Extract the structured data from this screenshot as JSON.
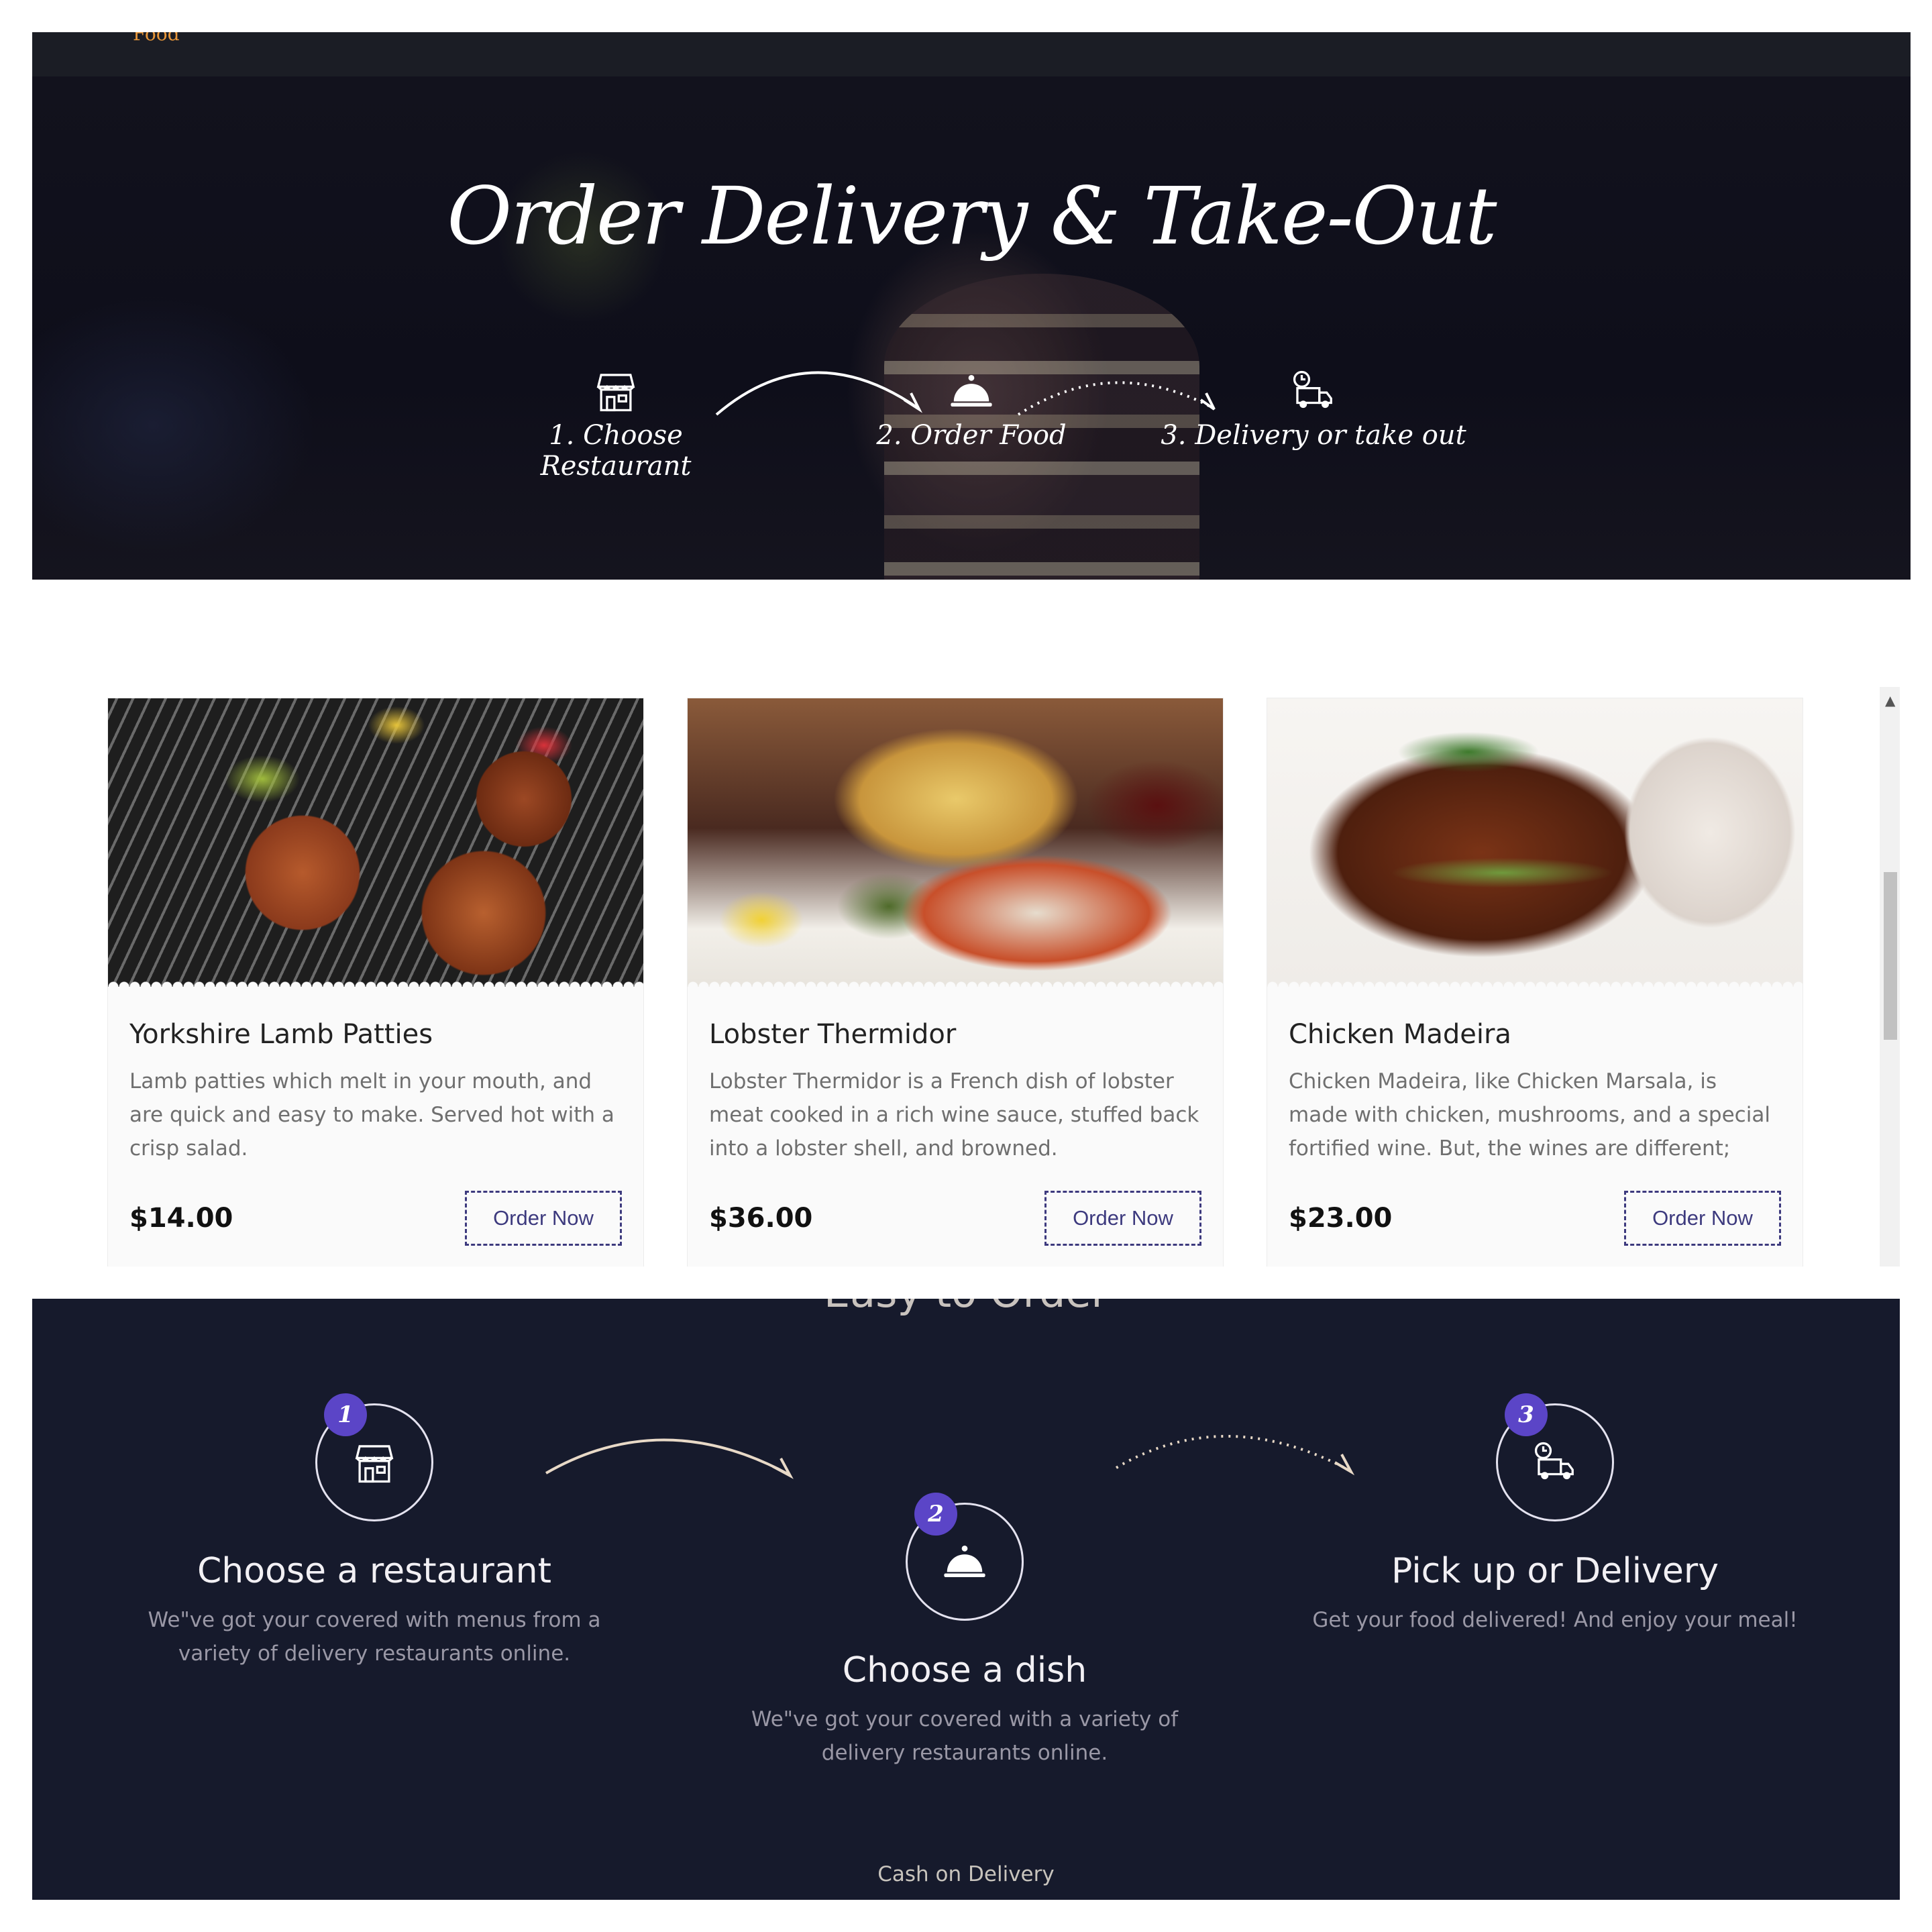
{
  "hero": {
    "logo_text": "Food",
    "title": "Order Delivery & Take-Out",
    "steps": [
      {
        "label": "1. Choose Restaurant",
        "icon": "store-icon"
      },
      {
        "label": "2. Order Food",
        "icon": "cloche-icon"
      },
      {
        "label": "3. Delivery or take out",
        "icon": "delivery-truck-icon"
      }
    ]
  },
  "cards": [
    {
      "name": "Yorkshire Lamb Patties",
      "description": "Lamb patties which melt in your mouth, and are quick and easy to make. Served hot with a crisp salad.",
      "price": "$14.00",
      "button": "Order Now"
    },
    {
      "name": "Lobster Thermidor",
      "description": "Lobster Thermidor is a French dish of lobster meat cooked in a rich wine sauce, stuffed back into a lobster shell, and browned.",
      "price": "$36.00",
      "button": "Order Now"
    },
    {
      "name": "Chicken Madeira",
      "description": "Chicken Madeira, like Chicken Marsala, is made with chicken, mushrooms, and a special fortified wine. But, the wines are different;",
      "price": "$23.00",
      "button": "Order Now"
    }
  ],
  "easy": {
    "title": "Easy to Order",
    "steps": [
      {
        "number": "1",
        "title": "Choose a restaurant",
        "description": "We\"ve got your covered with menus from a variety of delivery restaurants online.",
        "icon": "store-icon"
      },
      {
        "number": "2",
        "title": "Choose a dish",
        "description": "We\"ve got your covered with a variety of delivery restaurants online.",
        "icon": "cloche-icon"
      },
      {
        "number": "3",
        "title": "Pick up or Delivery",
        "description": "Get your food delivered! And enjoy your meal!",
        "icon": "delivery-truck-icon"
      }
    ],
    "footer": "Cash on Delivery"
  },
  "colors": {
    "accent": "#5b45c7",
    "button_border": "#3d3a7e",
    "dark_bg": "#161a2c"
  }
}
